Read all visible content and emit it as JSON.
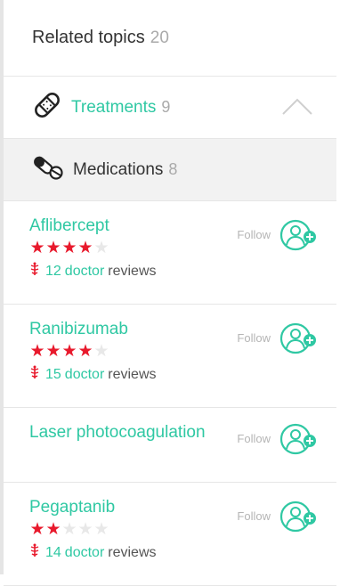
{
  "header": {
    "title": "Related topics",
    "count": "20"
  },
  "sections": {
    "treatments": {
      "label": "Treatments",
      "count": "9"
    },
    "medications": {
      "label": "Medications",
      "count": "8"
    }
  },
  "follow_label": "Follow",
  "items": [
    {
      "name": "Aflibercept",
      "rating": 4,
      "max_rating": 5,
      "reviews_count": "12",
      "doctor_word": "doctor",
      "reviews_word": "reviews"
    },
    {
      "name": "Ranibizumab",
      "rating": 4,
      "max_rating": 5,
      "reviews_count": "15",
      "doctor_word": "doctor",
      "reviews_word": "reviews"
    },
    {
      "name": "Laser photocoagulation"
    },
    {
      "name": "Pegaptanib",
      "rating": 2,
      "max_rating": 5,
      "reviews_count": "14",
      "doctor_word": "doctor",
      "reviews_word": "reviews"
    }
  ],
  "colors": {
    "accent": "#2fc8a3",
    "star_on": "#e8192c",
    "star_off": "#e8e8e8"
  }
}
